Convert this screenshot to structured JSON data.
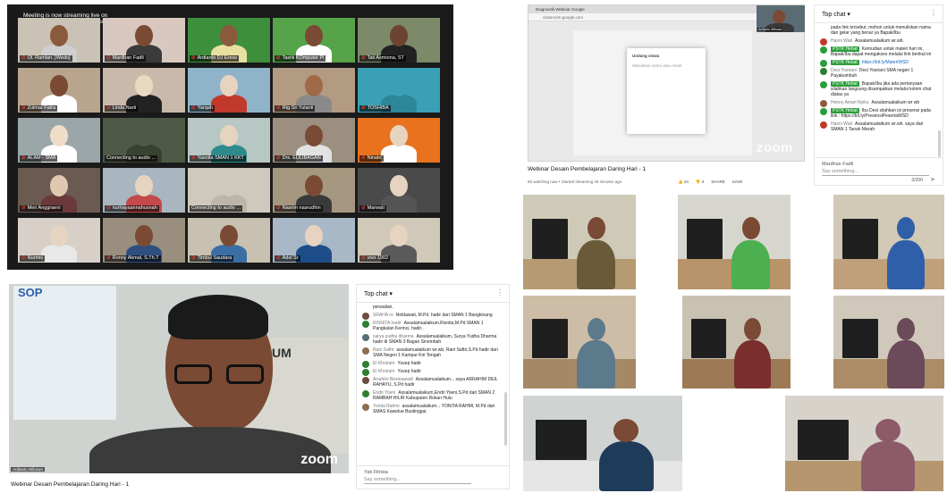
{
  "zoom_gallery": {
    "banner": "Meeting is now streaming live on Custom Live Streaming Service",
    "tiles": [
      {
        "label": "Ol. Ramlan. [Wedo]",
        "bg": "#c9c2b5",
        "skin": "#8a5a3c",
        "shirt": "#cfcfcf",
        "muted": true
      },
      {
        "label": "Mardhan Fadli",
        "bg": "#d9c8c0",
        "skin": "#7a4a34",
        "shirt": "#3a3a3a",
        "muted": true
      },
      {
        "label": "Ardianto DJ Ereso",
        "bg": "#3d8f3b",
        "skin": "#8a5a3c",
        "shirt": "#e8e0a0",
        "muted": true
      },
      {
        "label": "Taslik KOmputer Pl",
        "bg": "#57a34a",
        "skin": "#7a4a34",
        "shirt": "#ffffff",
        "muted": true
      },
      {
        "label": "Tati Asmiona, ST",
        "bg": "#7d8a6a",
        "skin": "#6b4330",
        "shirt": "#222222",
        "muted": true
      },
      {
        "label": "Zulmar Fatra",
        "bg": "#b9a58e",
        "skin": "#7a4a34",
        "shirt": "#ffffff",
        "muted": true
      },
      {
        "label": "Linda Narti",
        "bg": "#c9b9aa",
        "skin": "#ead9c0",
        "shirt": "#222222",
        "muted": true
      },
      {
        "label": "Yarqah",
        "bg": "#8fb4c9",
        "skin": "#e6d4c0",
        "shirt": "#c0392b",
        "muted": true
      },
      {
        "label": "Rtg.Sri Yulanti",
        "bg": "#b39a82",
        "skin": "#a06a48",
        "shirt": "#8a8a8a",
        "muted": true
      },
      {
        "label": "TOSHIBA",
        "bg": "#3aa0b6",
        "skin": "#3aa0b6",
        "shirt": "#2d8799",
        "muted": true
      },
      {
        "label": "ALAM - SMA",
        "bg": "#9aa6a8",
        "skin": "#f0ddc8",
        "shirt": "#ffffff",
        "muted": true
      },
      {
        "label": "Connecting to audio ...",
        "bg": "#4f5a46",
        "skin": "#4f5a46",
        "shirt": "#39412f",
        "muted": false
      },
      {
        "label": "Yasnita SMAN 1 KKT",
        "bg": "#b7c7c4",
        "skin": "#e6d4c0",
        "shirt": "#2e8b8b",
        "muted": true
      },
      {
        "label": "Drs. EULIBAGAN",
        "bg": "#9c8f80",
        "skin": "#7a4a34",
        "shirt": "#e2e2e2",
        "muted": true
      },
      {
        "label": "Ninatri",
        "bg": "#e8721d",
        "skin": "#e6d4c0",
        "shirt": "#ffffff",
        "muted": true
      },
      {
        "label": "Meri Anggraeni",
        "bg": "#6a5a50",
        "skin": "#e0c8b0",
        "shirt": "#6a3a3a",
        "muted": true
      },
      {
        "label": "nurhayaannahusnah",
        "bg": "#a9b6c0",
        "skin": "#e6d4c0",
        "shirt": "#c44a4a",
        "muted": true
      },
      {
        "label": "Connecting to audio ...",
        "bg": "#cfc8bc",
        "skin": "#cfc8bc",
        "shirt": "#bdb5a8",
        "muted": false
      },
      {
        "label": "Nasrim nasrudhin",
        "bg": "#a5977f",
        "skin": "#7a4a34",
        "shirt": "#3a3a3a",
        "muted": true
      },
      {
        "label": "Marwati",
        "bg": "#4a4a4a",
        "skin": "#e6d4c0",
        "shirt": "#555555",
        "muted": true
      },
      {
        "label": "Nurmis",
        "bg": "#d8d0c8",
        "skin": "#e6d4c0",
        "shirt": "#e8e8e8",
        "muted": true
      },
      {
        "label": "Ronny Akmal, S.Th.T",
        "bg": "#9a8e7e",
        "skin": "#7a4a34",
        "shirt": "#2f4f7f",
        "muted": true
      },
      {
        "label": "Timbul Saudara",
        "bg": "#c8c0b0",
        "skin": "#7a4a34",
        "shirt": "#3a6ea5",
        "muted": true
      },
      {
        "label": "Adel Sr",
        "bg": "#a8b8c6",
        "skin": "#e6d4c0",
        "shirt": "#1e4e8a",
        "muted": true
      },
      {
        "label": "vivo 1902",
        "bg": "#d0c8b8",
        "skin": "#e6d4c0",
        "shirt": "#5a5a5a",
        "muted": true
      }
    ]
  },
  "yt_top": {
    "browser_tab": "Diagnostik Webinar Google",
    "url": "classroom.google.com",
    "dialog_title": "Undang siswa",
    "dialog_body": "Masukkan nama atau email",
    "zoom_watermark": "zoom",
    "presenter_tag": "Ardianto Wibowo",
    "video_title": "Webinar Desain Pembelajaran Daring Hari - 1",
    "meta": "93 watching now • Started streaming 40 minutes ago",
    "actions": [
      "24",
      "0",
      "SHARE",
      "SAVE"
    ]
  },
  "chat_top": {
    "header": "Top chat",
    "messages": [
      {
        "author": "",
        "text": "pada link tersebut, mohon untuk menuliskan nama dan gelar yang benar ya Bapak/Ibu",
        "mod": false,
        "color": "#ffffff"
      },
      {
        "author": "Hasni Wati",
        "text": "Assalamualaikum wr.wb.",
        "mod": false,
        "color": "#c0392b"
      },
      {
        "author": "PSTK Hebat",
        "text": "Kemudian untuk materi hari ini, Bapak/Ibu dapat mengakses melalui link berikut ini",
        "mod": true,
        "color": "#2a9d3a"
      },
      {
        "author": "PSTK Hebat",
        "text": "https://bit.ly/MateriWSD",
        "mod": true,
        "color": "#2a9d3a",
        "link": true
      },
      {
        "author": "Desi Yosriani",
        "text": "Desi Yosriani SMA negeri 1 Payakumbuh",
        "mod": false,
        "color": "#2e7d32"
      },
      {
        "author": "PSTK Hebat",
        "text": "Bapak/Ibu jika ada pertanyaan silahkan langsung disampaikan melalui kolom chat diatas ya",
        "mod": true,
        "color": "#2a9d3a"
      },
      {
        "author": "Henny Amari Nyiku",
        "text": "Assalamualaikum wr wb",
        "mod": false,
        "color": "#8d5a3b"
      },
      {
        "author": "PSTK Hebat",
        "text": "Ibu Desi silahkan isi presensi pada link : https://bit.ly/PresensiPesertaWSD",
        "mod": true,
        "color": "#2a9d3a"
      },
      {
        "author": "Hasni Wati",
        "text": "Assalamualaikum wr.wb. saya dari SMAN 1 Tanah Merah",
        "mod": false,
        "color": "#c0392b"
      }
    ],
    "input_user": "Mardhan Fadli",
    "input_placeholder": "Say something...",
    "counter": "0/200"
  },
  "presenter": {
    "sop_title": "SOP",
    "poster_text": "RIUM",
    "zoom_watermark": "zoom",
    "presenter_tag": "Ardianto Wibowo",
    "video_title": "Webinar Desain Pembelajaran Daring Hari - 1"
  },
  "chat_bottom": {
    "header": "Top chat",
    "messages": [
      {
        "author": "",
        "text": "perwalian.",
        "color": "#ffffff"
      },
      {
        "author": "SRAHA ro",
        "text": "Noldawati, M.Pd. hadir dari SMAN 1 Bangkinang",
        "color": "#6d4c41"
      },
      {
        "author": "RISNITA hadir",
        "text": "Assalamualaikum.Risnita,M.Pd SMAN 1 Pangkalan Kerinci, hadir..",
        "color": "#2e7d32"
      },
      {
        "author": "sarya yudha dharma",
        "text": "Assalamualaikum, Surya Yudha Dharma hadir di SMAN 3 Bagan Sinembah",
        "color": "#546e7a"
      },
      {
        "author": "Rani Saftri",
        "text": "assalamualaikum wr.wb, Rani Saftri,S.Pd hadir dari SMA Negeri 1 Kampar Kiri Tengah",
        "color": "#8e6e53"
      },
      {
        "author": "El Khoiram",
        "text": "Yusep hadir",
        "color": "#2e7d32"
      },
      {
        "author": "El Khoiram",
        "text": "Yusep hadir",
        "color": "#2e7d32"
      },
      {
        "author": "Arrahim Besteawadi",
        "text": "Assalamualaikum... saya ARRAHIM DEIL RAHAYU, S.Pd hadir",
        "color": "#6d4c41"
      },
      {
        "author": "Endri Yoeni",
        "text": "Assalamualaikum,Endri Yoeni,S.Pd dari SMAN 2 RAMBAH HILIR Kabupaten Rokan Hulu",
        "color": "#2e7d32"
      },
      {
        "author": "Yonita Rahmi",
        "text": "assalamualaikum... YONITA RAHMI, M.Pd dari SMAS Kawelue Bustinggai",
        "color": "#8e6e53"
      }
    ],
    "input_user": "Yati Fitrisia",
    "input_placeholder": "Say something..."
  },
  "photos": [
    {
      "wall": "#cfc9b8",
      "desk": "#b59a72",
      "skin": "#7a4a34",
      "shirt": "#6b5a3a",
      "hijab": false
    },
    {
      "wall": "#d6d6cf",
      "desk": "#b8946a",
      "skin": "#7a4a34",
      "shirt": "#4caf50",
      "hijab": false
    },
    {
      "wall": "#d2c9b6",
      "desk": "#c0a07a",
      "skin": "#e6d4c0",
      "shirt": "#2f5fa8",
      "hijab": true
    },
    {
      "wall": "#cdbda6",
      "desk": "#a58967",
      "skin": "#c62828",
      "shirt": "#5d7a8c",
      "hijab": true
    },
    {
      "wall": "#c9c2b3",
      "desk": "#9c7a55",
      "skin": "#7a4a34",
      "shirt": "#7a2e2e",
      "hijab": false
    },
    {
      "wall": "#d0c8bb",
      "desk": "#ab8c66",
      "skin": "#6b4a5a",
      "shirt": "#6b4a5a",
      "hijab": true
    },
    {
      "wall": "#cfd3d2",
      "desk": "#e5e5e5",
      "skin": "#7a4a34",
      "shirt": "#1f3b5a",
      "hijab": false
    },
    {
      "wall": "#d8d3ca",
      "desk": "#b5966e",
      "skin": "#8d5a6a",
      "shirt": "#8d5a6a",
      "hijab": true
    }
  ]
}
